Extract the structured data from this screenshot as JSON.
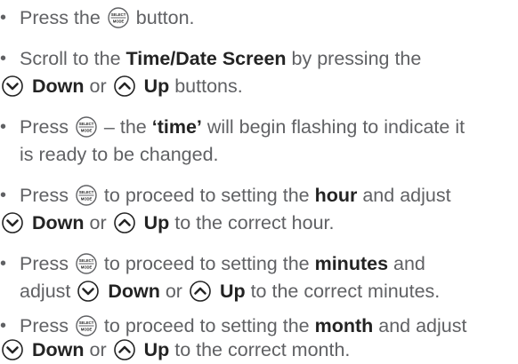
{
  "bullet": "•",
  "items": [
    {
      "a": "Press the ",
      "b": " button."
    },
    {
      "a": "Scroll to the ",
      "bold1": "Time/Date Screen",
      "b": " by pressing the",
      "down": "Down",
      "or": " or ",
      "up": "Up",
      "c": " buttons."
    },
    {
      "a": "Press ",
      "b": " – the ",
      "bold1": "‘time’",
      "c": " will begin flashing to indicate it",
      "d": "is ready to be changed."
    },
    {
      "a": "Press ",
      "b": " to proceed to setting the ",
      "bold1": "hour",
      "c": " and adjust",
      "down": "Down",
      "or": " or ",
      "up": "Up",
      "d": " to the correct hour."
    },
    {
      "a": "Press ",
      "b": " to proceed to setting the ",
      "bold1": "minutes",
      "c": " and",
      "d": "adjust ",
      "down": "Down",
      "or": " or ",
      "up": "Up",
      "e": " to the correct minutes."
    },
    {
      "a": "Press ",
      "b": " to proceed to setting the ",
      "bold1": "month",
      "c": " and adjust",
      "down": "Down",
      "or": " or ",
      "up": "Up",
      "d": " to the correct month."
    }
  ],
  "select_icon": {
    "top": "SELECT",
    "bottom": "MODE"
  },
  "icons": {
    "select": "select-mode-button-icon",
    "down": "down-chevron-icon",
    "up": "up-chevron-icon"
  }
}
